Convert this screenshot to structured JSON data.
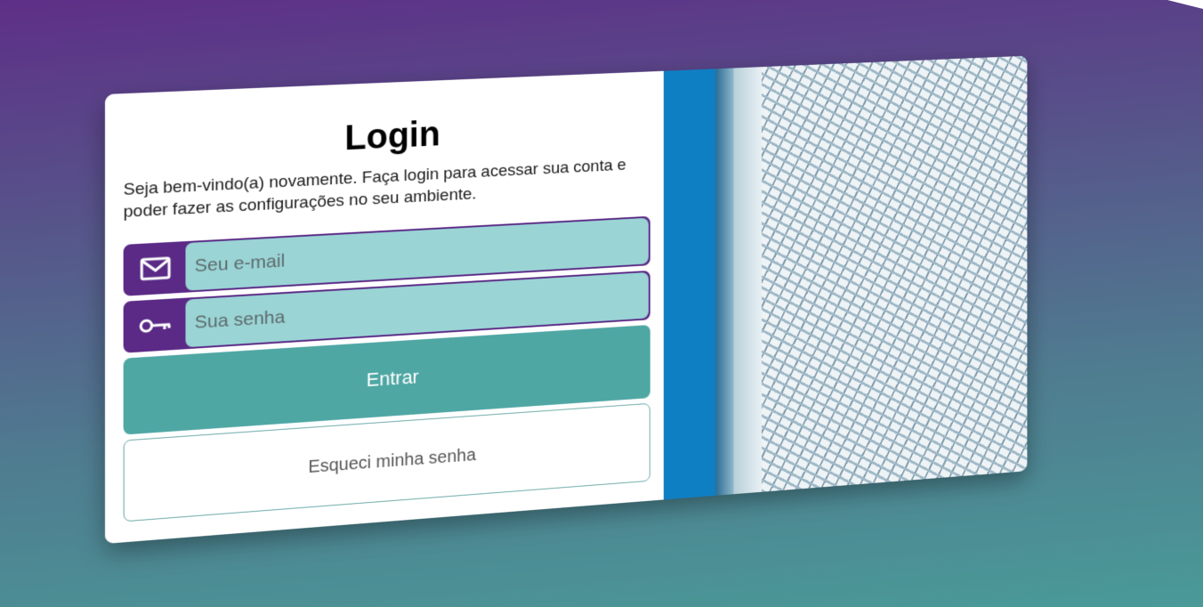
{
  "login": {
    "title": "Login",
    "subtitle": "Seja bem-vindo(a) novamente. Faça login para acessar sua conta e poder fazer as configurações no seu ambiente.",
    "email": {
      "placeholder": "Seu e-mail",
      "value": "",
      "icon": "envelope-icon"
    },
    "password": {
      "placeholder": "Sua senha",
      "value": "",
      "icon": "key-icon"
    },
    "submit_label": "Entrar",
    "forgot_label": "Esqueci minha senha"
  },
  "colors": {
    "accent_purple": "#5a2a86",
    "input_bg": "#9ad4d5",
    "primary_button": "#4fa7a4"
  }
}
